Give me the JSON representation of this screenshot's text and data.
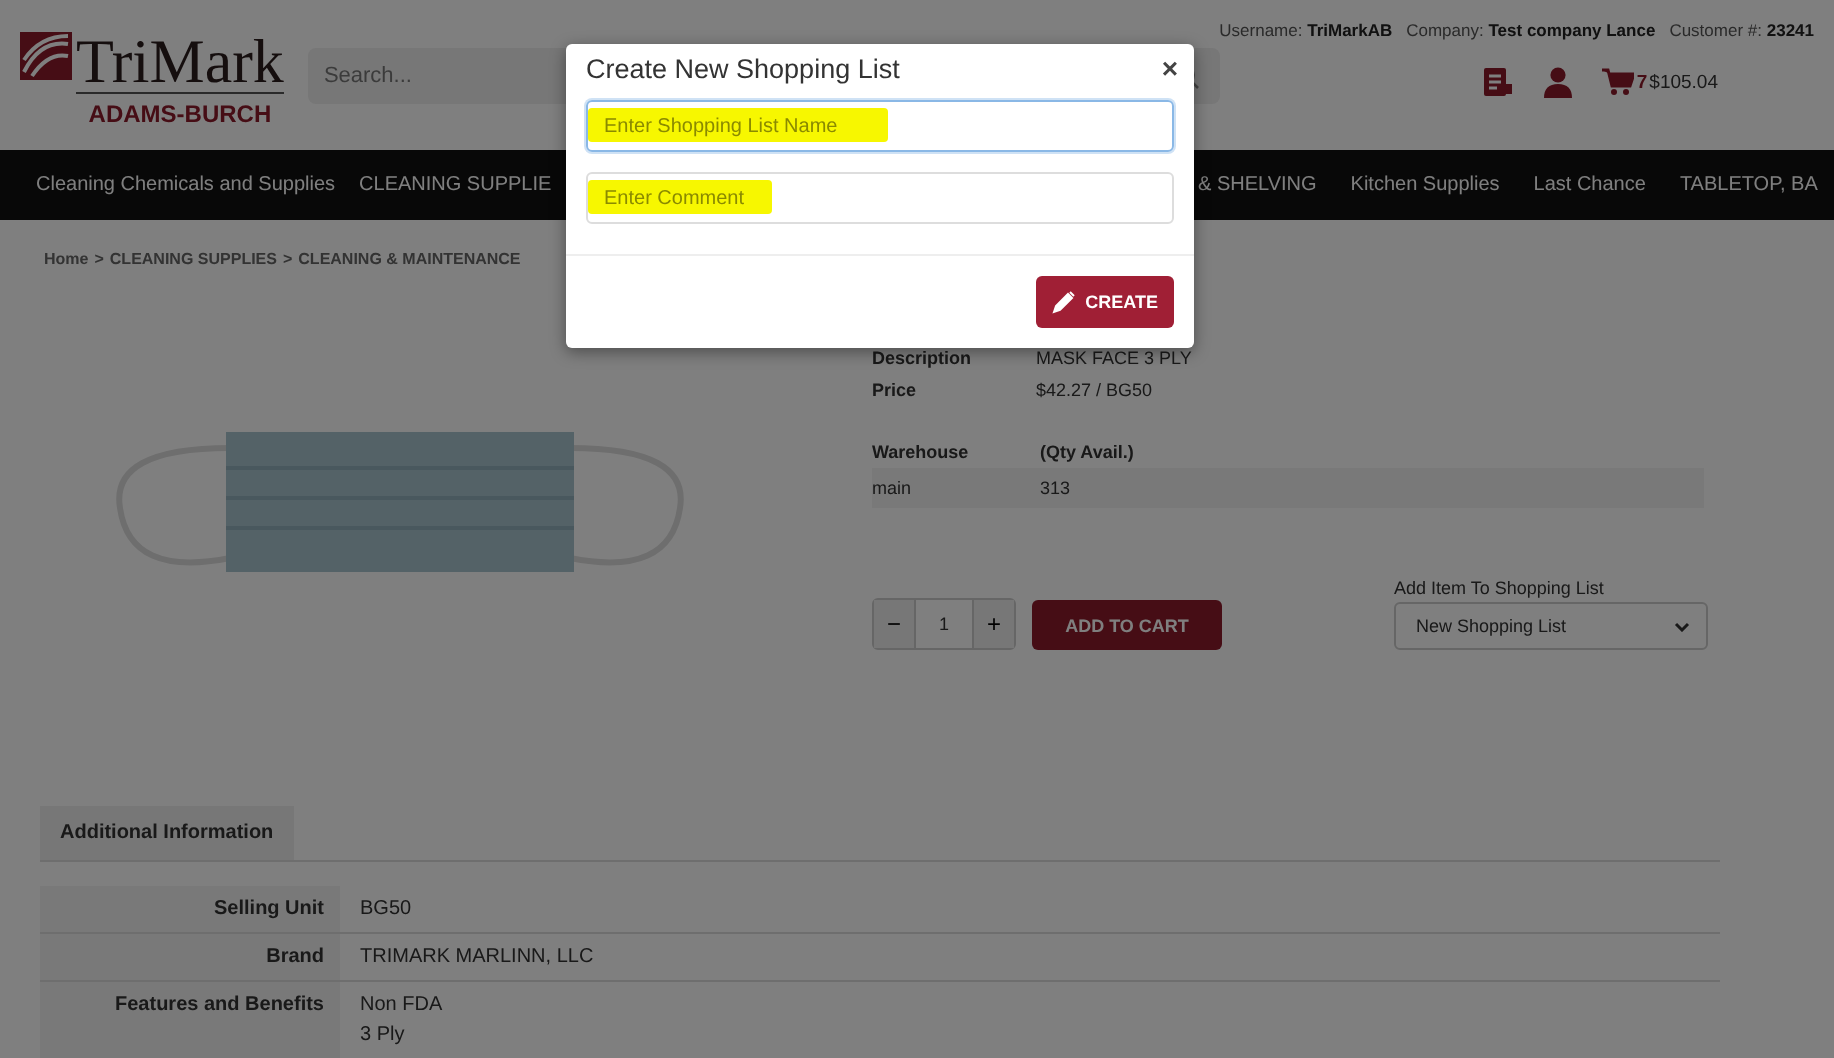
{
  "header": {
    "logo": {
      "name": "TriMark",
      "sub": "ADAMS-BURCH"
    },
    "search": {
      "placeholder": "Search..."
    },
    "account": [
      {
        "label": "Username:",
        "value": "TriMarkAB"
      },
      {
        "label": "Company:",
        "value": "Test company Lance"
      },
      {
        "label": "Customer #:",
        "value": "23241"
      }
    ],
    "cart": {
      "count": "7",
      "total": "$105.04"
    }
  },
  "nav": {
    "items_left": [
      "Cleaning Chemicals and Supplies",
      "CLEANING SUPPLIE"
    ],
    "items_right": [
      "& SHELVING",
      "Kitchen Supplies",
      "Last Chance",
      "TABLETOP, BA"
    ]
  },
  "breadcrumb": {
    "separator": ">",
    "items": [
      "Home",
      "CLEANING SUPPLIES",
      "CLEANING & MAINTENANCE"
    ]
  },
  "product": {
    "details": [
      {
        "label": "Description",
        "value": "MASK FACE 3 PLY"
      },
      {
        "label": "Price",
        "value": "$42.27 / BG50"
      }
    ],
    "stock": {
      "columns": [
        "Warehouse",
        "(Qty Avail.)"
      ],
      "rows": [
        [
          "main",
          "313"
        ]
      ]
    },
    "quantity": {
      "minus": "−",
      "value": "1",
      "plus": "+"
    },
    "add_to_cart": "ADD TO CART",
    "shopping_list": {
      "label": "Add Item To Shopping List",
      "value": "New Shopping List"
    }
  },
  "tabs": [
    {
      "label": "Additional Information",
      "selected": true
    }
  ],
  "attributes": [
    {
      "label": "Selling Unit",
      "values": [
        "BG50"
      ]
    },
    {
      "label": "Brand",
      "values": [
        "TRIMARK MARLINN, LLC"
      ]
    },
    {
      "label": "Features and Benefits",
      "values": [
        "Non FDA",
        "3 Ply"
      ]
    }
  ],
  "modal": {
    "title": "Create New Shopping List",
    "close": "×",
    "fields": [
      {
        "placeholder": "Enter Shopping List Name",
        "focused": true,
        "highlighted": true
      },
      {
        "placeholder": "Enter Comment",
        "focused": false,
        "highlighted": true
      }
    ],
    "button": "CREATE"
  }
}
